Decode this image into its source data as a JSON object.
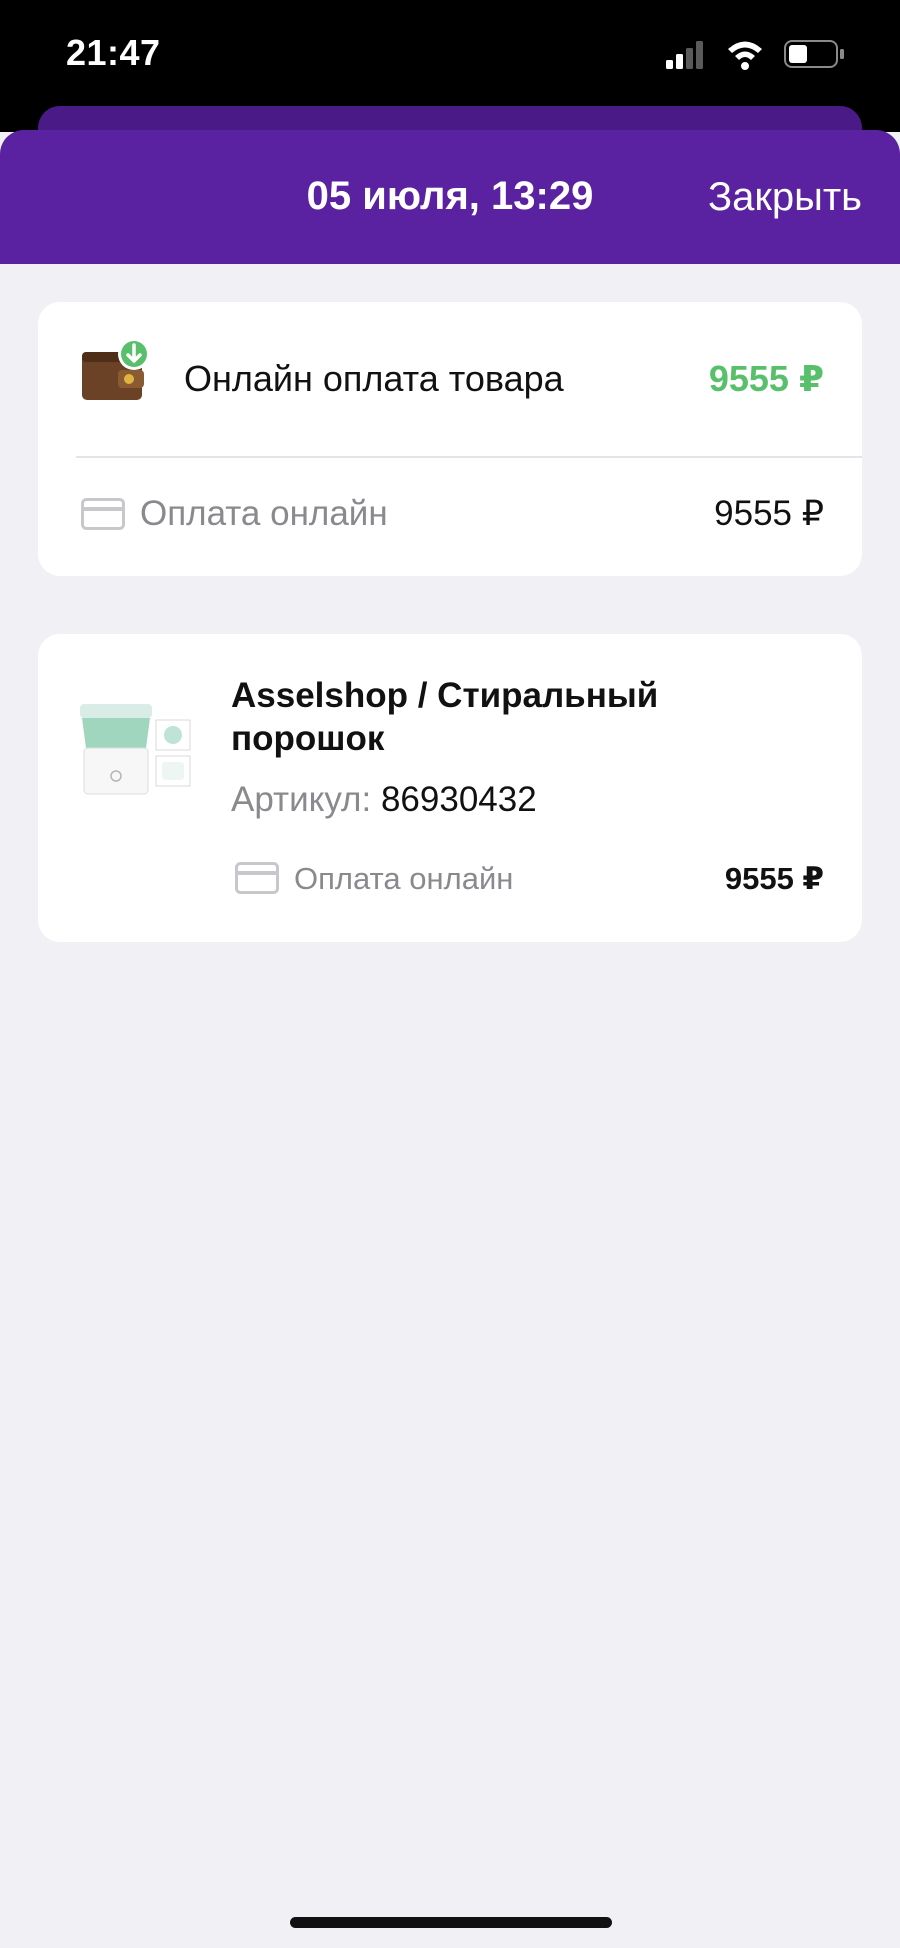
{
  "status_bar": {
    "time": "21:47",
    "icons": [
      "signal-icon",
      "wifi-icon",
      "battery-icon"
    ]
  },
  "header": {
    "title": "05 июля, 13:29",
    "close_label": "Закрыть",
    "color": "#5a21a0"
  },
  "payment_summary": {
    "icon": "wallet-download-icon",
    "label": "Онлайн оплата товара",
    "amount": "9555 ₽",
    "amount_color": "#58c06a",
    "method": {
      "icon": "card-icon",
      "label": "Оплата онлайн",
      "amount": "9555 ₽"
    }
  },
  "product": {
    "image": "washing-machine-image",
    "title": "Asselshop / Стиральный порошок",
    "article_label": "Артикул:",
    "article_value": "86930432",
    "method": {
      "icon": "card-icon",
      "label": "Оплата онлайн",
      "amount": "9555 ₽"
    }
  }
}
